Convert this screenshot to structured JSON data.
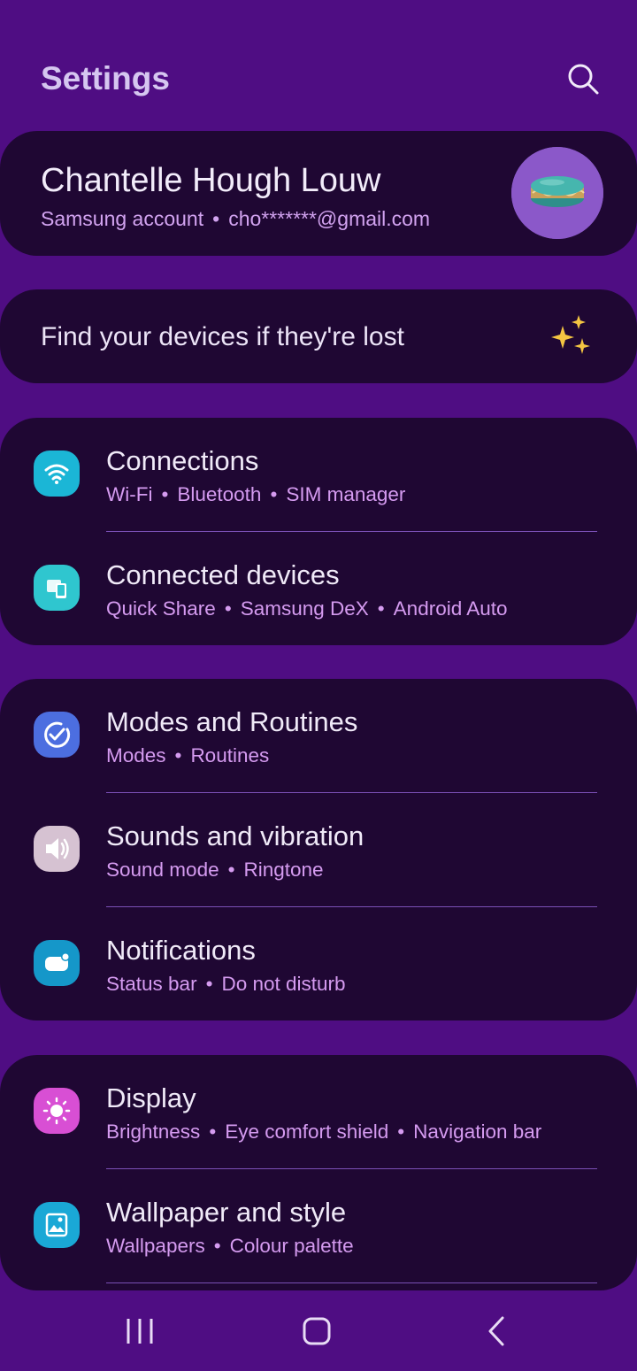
{
  "header": {
    "title": "Settings",
    "search_icon": "search-icon"
  },
  "account": {
    "name": "Chantelle Hough Louw",
    "service": "Samsung account",
    "email": "cho*******@gmail.com",
    "avatar": "macaron-avatar"
  },
  "find_devices": {
    "label": "Find your devices if they're lost",
    "icon": "sparkle-icon"
  },
  "groups": [
    {
      "items": [
        {
          "title": "Connections",
          "subs": [
            "Wi-Fi",
            "Bluetooth",
            "SIM manager"
          ],
          "icon": "wifi-icon",
          "color": "#1bb6d6"
        },
        {
          "title": "Connected devices",
          "subs": [
            "Quick Share",
            "Samsung DeX",
            "Android Auto"
          ],
          "icon": "devices-icon",
          "color": "#2fc6cf"
        }
      ]
    },
    {
      "items": [
        {
          "title": "Modes and Routines",
          "subs": [
            "Modes",
            "Routines"
          ],
          "icon": "check-circle-icon",
          "color": "#4c6ee0"
        },
        {
          "title": "Sounds and vibration",
          "subs": [
            "Sound mode",
            "Ringtone"
          ],
          "icon": "speaker-icon",
          "color": "#d6c2d2"
        },
        {
          "title": "Notifications",
          "subs": [
            "Status bar",
            "Do not disturb"
          ],
          "icon": "notification-icon",
          "color": "#1597c9"
        }
      ]
    },
    {
      "items": [
        {
          "title": "Display",
          "subs": [
            "Brightness",
            "Eye comfort shield",
            "Navigation bar"
          ],
          "icon": "sun-icon",
          "color": "#d84fd4"
        },
        {
          "title": "Wallpaper and style",
          "subs": [
            "Wallpapers",
            "Colour palette"
          ],
          "icon": "wallpaper-icon",
          "color": "#1aa8d6"
        }
      ]
    }
  ],
  "navbar": {
    "recents": "recents-icon",
    "home": "home-icon",
    "back": "back-icon"
  }
}
